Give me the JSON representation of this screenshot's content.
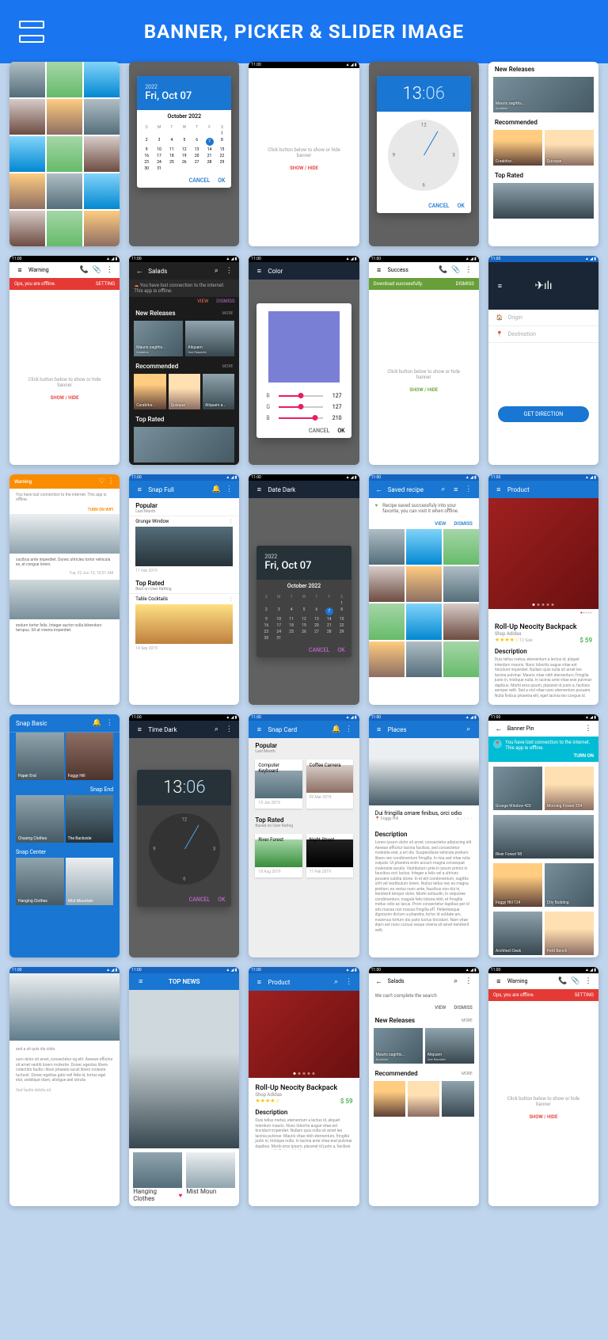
{
  "header": {
    "title": "BANNER, PICKER & SLIDER IMAGE"
  },
  "status_time": "11:00",
  "screens": {
    "date_light": {
      "year": "2022",
      "date": "Fri, Oct 07",
      "month": "October 2022",
      "selected": "7",
      "cancel": "CANCEL",
      "ok": "OK"
    },
    "date_dark": {
      "title": "Date Dark",
      "year": "2022",
      "date": "Fri, Oct 07",
      "month": "October 2022",
      "selected": "7",
      "cancel": "CANCEL",
      "ok": "OK"
    },
    "time_light": {
      "hour": "13",
      "minute": "06",
      "cancel": "CANCEL",
      "ok": "OK"
    },
    "time_dark": {
      "title": "Time Dark",
      "hour": "13",
      "minute": "06",
      "cancel": "CANCEL",
      "ok": "OK"
    },
    "hide_banner": {
      "msg": "Click button below to show or hide banner",
      "action": "SHOW / HIDE"
    },
    "warning": {
      "title": "Warning",
      "offline": "Ops, you are offline.",
      "setting": "SETTING",
      "msg": "Click button below to show or hide banner",
      "action": "SHOW / HIDE"
    },
    "success": {
      "title": "Success",
      "banner": "Download successfully.",
      "dismiss": "DISMISS",
      "msg": "Click button below to show or hide banner",
      "action": "SHOW / HIDE"
    },
    "salads_dark": {
      "title": "Salads",
      "conn_msg": "You have lost connection to the internet. This app is offline.",
      "view": "VIEW",
      "dismiss": "DISMISS",
      "new_rel": "New Releases",
      "more": "MORE",
      "rec": "Recommended",
      "top": "Top Rated",
      "item1": "Mauris sagittis...",
      "item1s": "Kodaline",
      "item2": "Aliquam",
      "item2s": "One Republic",
      "chip1": "Curabitur...",
      "chip2": "Quisque",
      "chip3": "Aliquam a..."
    },
    "salads_light": {
      "title": "Salads",
      "search_fail": "We can't complete the search",
      "view": "VIEW",
      "dismiss": "DISMISS",
      "new_rel": "New Releases",
      "more": "MORE",
      "rec": "Recommended",
      "item1": "Mauris sagittis...",
      "item1s": "Kodaline",
      "item2": "Aliquam",
      "item2s": "One Republic"
    },
    "color": {
      "title": "Color",
      "r": "R",
      "g": "G",
      "b": "B",
      "rv": "127",
      "gv": "127",
      "bv": "210",
      "cancel": "CANCEL",
      "ok": "OK"
    },
    "route": {
      "origin": "Origin",
      "dest": "Destination",
      "btn": "GET DIRECTION"
    },
    "org_warning": {
      "title": "Warning",
      "conn_msg": "You have lost connection to the internet. This app is offline.",
      "wifi": "TURN ON WIFI",
      "p1": "sucibus ante imperdiet. Donec ultricies tortor vehicula ex, at congue lorem.",
      "d1": "Tue, 22 Jun 10, 10:01 AM",
      "p2": "endum tortor felis. Integer auctor nulla bibendum tempus. Sit at viverra imperdiet."
    },
    "snap_full": {
      "title": "Snap Full",
      "popular": "Popular",
      "popular_sub": "Last Month",
      "item1": "Grunge Window",
      "date1": "11 Feb 2019",
      "top": "Top Rated",
      "top_sub": "Best on User Ratting",
      "item2": "Table Cocktails",
      "date2": "14 Sep 2019"
    },
    "saved_recipe": {
      "title": "Saved recipe",
      "msg": "Recipe saved successfuly into your favorite, you can visit it when offline.",
      "view": "VIEW",
      "dismiss": "DISMISS"
    },
    "product": {
      "title": "Product",
      "name": "Roll-Up Neocity Backpack",
      "brand": "Shop Adidas",
      "stars": "★★★★☆",
      "review": "12 Sale",
      "price": "$ 59",
      "desc": "Description",
      "lorem": "Duis tellus metus, elementum a lectus id, aliquet interdum mauris. Nunc lobortis augue vitae est tincidunt imperdiet. Nullam quis nulla sit amet leo lacinia pulvinar. Mauris vitae nibh elementum, fringilla justo in, tristique nulla. In lacinia ante vitae erat pulvinar dapibus. Morbi eros ipsum, placerat id justo a, facilisis semper velit. Sed a nisl vitae nunc elementum posuere. Nulla finibus pharetra elit, eget lacinia leo congue id."
    },
    "snap_basic": {
      "title": "Snap Basic",
      "snap_end": "Snap End",
      "snap_center": "Snap Center",
      "i1": "Paper End",
      "i2": "Foggy Hill",
      "i3": "Chasing Clothes",
      "i4": "The Backside",
      "i5": "Hanging Clothes",
      "i6": "Mist Mountain"
    },
    "snap_card": {
      "title": "Snap Card",
      "popular": "Popular",
      "popular_sub": "Last Month",
      "c1": "Computer Keyboard",
      "d1": "15 Jan 2019",
      "c2": "Coffee Camera",
      "d2": "09 Mar 2019",
      "top": "Top Rated",
      "top_sub": "Based on User Rating",
      "c3": "River Forest",
      "d3": "18 Aug 2019",
      "c4": "Night Street",
      "d4": "11 Feb 2019"
    },
    "places": {
      "title": "Places",
      "loc": "Dui fringilla ornare finibus, orci odio",
      "loc_sub": "Foggy Hill",
      "desc": "Description",
      "lorem": "Lorem ipsum dolor sit amet, consectetur adipiscing elit. Aenean efficitur lacinia facilisis, sed consectetur molestie erat, a ert dis. Suspendisse vehicula pretium libero nec condimentum fringilla. In risa sed vitae rutia vulpute. Ut pharetra enim accum magna consequat molenstie iaculis. Vestibulum ante in ipsum primis in faucibus orci luctus. Integer a felis vel a ultrices posuere cubilia stone. In et elit condimentum, sagittis ulrit vel vestibulum lorem. Nullus tellus nec eu magna pretium, eu verius nunc ante, faucibus non dui in, hendrerit tempor dolor. Morbi sollusdin, In velputree condimentum, magula felis lobora nibh, et fringilla metus odio ac lacus. Proin consectetur dapibus per id utis massa non massa fringilla eff. Pellentesque dignissim dictum a pharetra, tortor id soldate am, maximus tortum dis justo luctus tincidunt. Nam vitae diam est nunc cursus neque viverra sit amet hendrerit velit."
    },
    "banner_pin": {
      "title": "Banner Pin",
      "msg": "You have lost connection to the internet. This app is offline.",
      "turn": "TURN ON",
      "i1": "Grunge Window",
      "n1": "420",
      "i2": "Morning Flower",
      "n2": "234",
      "i3": "River Forest",
      "n3": "98",
      "i4": "Foggy Hill",
      "n4": "124",
      "i5": "City Building",
      "i6": "Architect Desk",
      "i7": "Petit Bench"
    },
    "top_news": {
      "title": "TOP NEWS",
      "item1": "Hanging Clothes",
      "item2": "Mist Moun"
    },
    "article": {
      "lorem": "and a sit quis dis cidio\n\nsum dolor sit amet, consectetur ng elit. Aenean efficitur sit amet vestib lorem molestie. Donec egestas libero colectdis faults i libun phaeats iaculi libero moleste tuctuulr. Donec egettas gato vell felle id, tortus egel elut, seddique diam, allotgue aiel istruta",
      "sub": "Sed faults dobitu sit"
    },
    "top_releases": {
      "new": "New Releases",
      "rec": "Recommended",
      "top": "Top Rated",
      "c1": "Curabitur...",
      "c2": "Quisque",
      "i1": "Mauris sagittis...",
      "i1s": "Kodaline"
    }
  }
}
